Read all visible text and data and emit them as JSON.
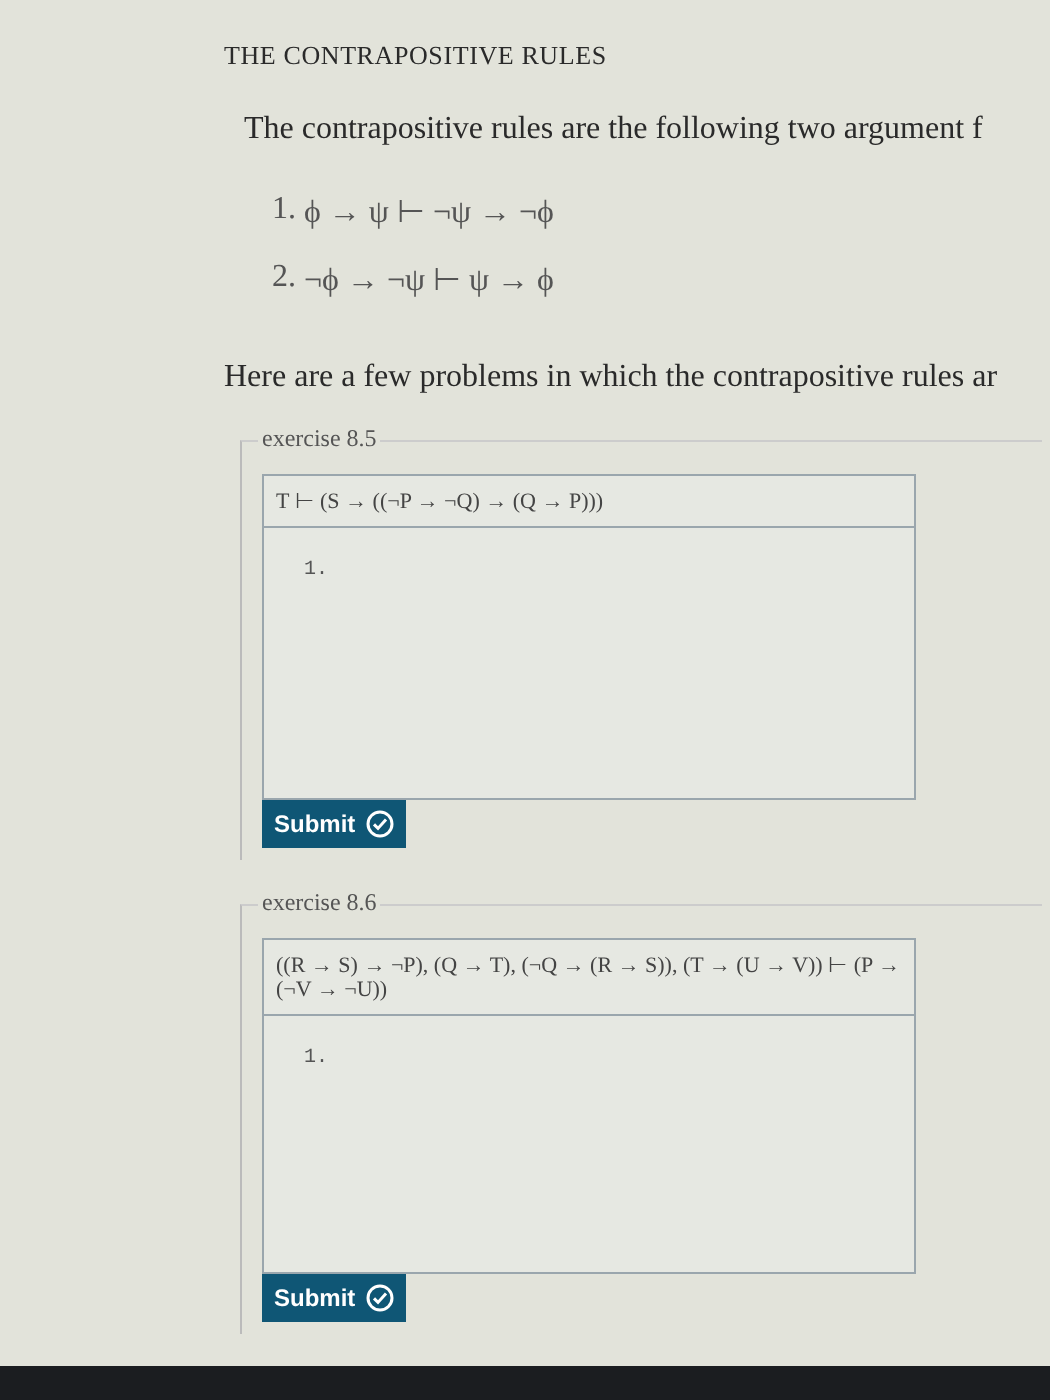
{
  "title": "THE CONTRAPOSITIVE RULES",
  "intro": "The contrapositive rules are the following two argument f",
  "rules": [
    {
      "number": "1.",
      "text": "ϕ → ψ ⊢ ¬ψ → ¬ϕ"
    },
    {
      "number": "2.",
      "text": "¬ϕ → ¬ψ ⊢ ψ → ϕ"
    }
  ],
  "problems_intro": "Here are a few problems in which the contrapositive rules ar",
  "exercises": [
    {
      "legend": "exercise 8.5",
      "premise": "T ⊢ (S → ((¬P → ¬Q) → (Q → P)))",
      "line_number": "1.",
      "submit": "Submit"
    },
    {
      "legend": "exercise 8.6",
      "premise": "((R → S) → ¬P), (Q → T), (¬Q → (R → S)), (T → (U → V)) ⊢ (P → (¬V → ¬U))",
      "line_number": "1.",
      "submit": "Submit"
    }
  ]
}
